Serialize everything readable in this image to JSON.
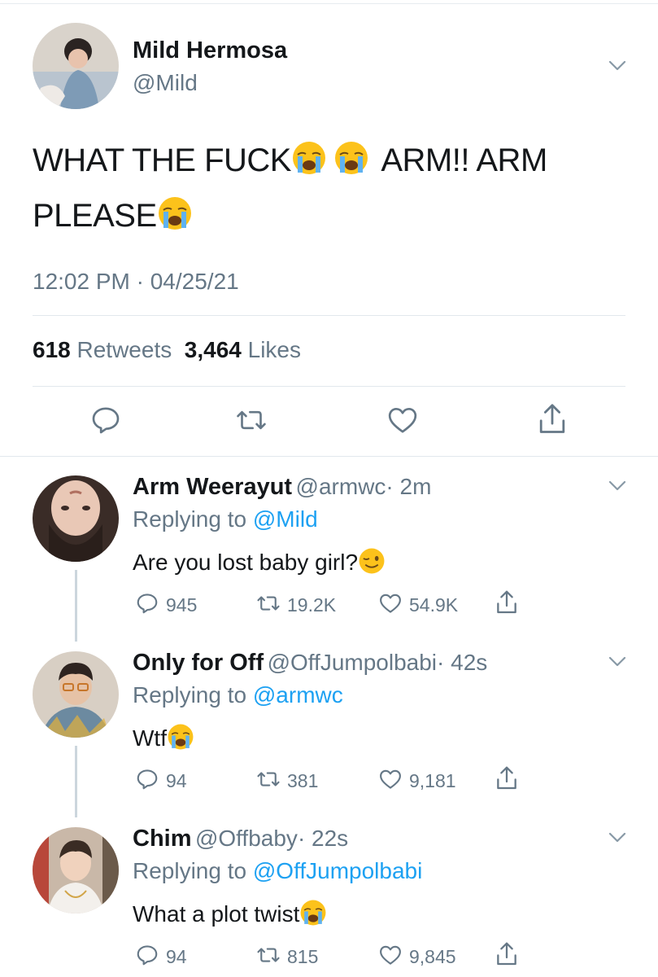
{
  "tweet": {
    "name": "Mild Hermosa",
    "handle": "@Mild",
    "text_part1": "WHAT THE FUCK",
    "text_part2": " ARM!! ARM",
    "text_part3": "PLEASE",
    "timestamp": "12:02 PM · 04/25/21",
    "retweets_count": "618",
    "retweets_label": "Retweets",
    "likes_count": "3,464",
    "likes_label": "Likes",
    "actions": [
      "reply-icon",
      "retweet-icon",
      "like-icon",
      "share-icon"
    ]
  },
  "replies": [
    {
      "name": "Arm Weerayut",
      "handle": "@armwc",
      "time": "· 2m",
      "replying_label": "Replying to",
      "replying_to": "@Mild",
      "text": "Are you lost baby girl?",
      "emoji": "winking-face",
      "replies": "945",
      "retweets": "19.2K",
      "likes": "54.9K"
    },
    {
      "name": "Only for Off",
      "handle": "@OffJumpolbabi",
      "time": "· 42s",
      "replying_label": "Replying to",
      "replying_to": "@armwc",
      "text": "Wtf",
      "emoji": "crying-face",
      "replies": "94",
      "retweets": "381",
      "likes": "9,181"
    },
    {
      "name": "Chim",
      "handle": "@Offbaby",
      "time": "· 22s",
      "replying_label": "Replying to",
      "replying_to": "@OffJumpolbabi",
      "text": "What a plot twist",
      "emoji": "crying-face",
      "replies": "94",
      "retweets": "815",
      "likes": "9,845"
    }
  ],
  "colors": {
    "link": "#1da1f2",
    "secondary_text": "#657786",
    "icon": "#657786",
    "divider": "#e1e8ed"
  }
}
